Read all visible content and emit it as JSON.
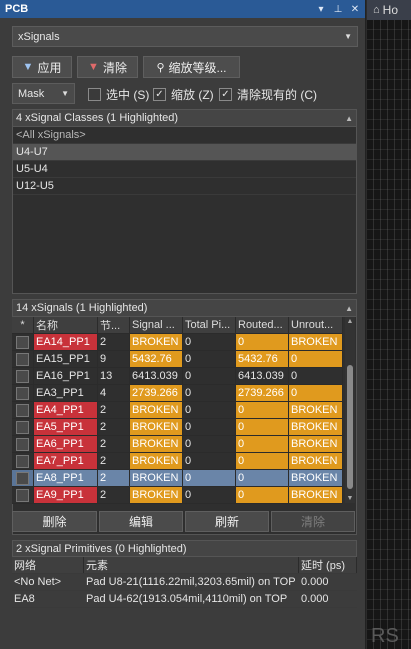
{
  "panel": {
    "title": "PCB",
    "controls": [
      "▾",
      "📌",
      "✕"
    ]
  },
  "type_select": {
    "value": "xSignals"
  },
  "toolbar": {
    "apply_label": "应用",
    "clear_label": "清除",
    "zoom_level_label": "缩放等级..."
  },
  "mask_select": {
    "value": "Mask"
  },
  "options": {
    "select_label": "选中 (S)",
    "select_checked": false,
    "zoom_label": "缩放 (Z)",
    "zoom_checked": true,
    "clear_existing_label": "清除现有的 (C)",
    "clear_existing_checked": true
  },
  "classes": {
    "header": "4 xSignal Classes (1 Highlighted)",
    "items": [
      {
        "label": "<All xSignals>",
        "state": "all"
      },
      {
        "label": "U4-U7",
        "state": "selected"
      },
      {
        "label": "U5-U4",
        "state": "normal"
      },
      {
        "label": "U12-U5",
        "state": "normal"
      }
    ]
  },
  "signals": {
    "header": "14 xSignals (1 Highlighted)",
    "columns": [
      "*",
      "名称",
      "节...",
      "Signal ...",
      "Total Pi...",
      "Routed...",
      "Unrout..."
    ],
    "rows": [
      {
        "name": "EA14_PP1",
        "nodes": "2",
        "signal": "BROKEN",
        "total": "0",
        "routed": "0",
        "unrouted": "BROKEN",
        "name_color": "red",
        "signal_color": "orange",
        "routed_color": "orange",
        "unrouted_color": "orange"
      },
      {
        "name": "EA15_PP1",
        "nodes": "9",
        "signal": "5432.76",
        "total": "0",
        "routed": "5432.76",
        "unrouted": "0",
        "name_color": "none",
        "signal_color": "orange",
        "routed_color": "orange",
        "unrouted_color": "orange"
      },
      {
        "name": "EA16_PP1",
        "nodes": "13",
        "signal": "6413.039",
        "total": "0",
        "routed": "6413.039",
        "unrouted": "0",
        "name_color": "none",
        "signal_color": "none",
        "routed_color": "none",
        "unrouted_color": "none"
      },
      {
        "name": "EA3_PP1",
        "nodes": "4",
        "signal": "2739.266",
        "total": "0",
        "routed": "2739.266",
        "unrouted": "0",
        "name_color": "none",
        "signal_color": "orange",
        "routed_color": "orange",
        "unrouted_color": "orange"
      },
      {
        "name": "EA4_PP1",
        "nodes": "2",
        "signal": "BROKEN",
        "total": "0",
        "routed": "0",
        "unrouted": "BROKEN",
        "name_color": "red",
        "signal_color": "orange",
        "routed_color": "orange",
        "unrouted_color": "orange"
      },
      {
        "name": "EA5_PP1",
        "nodes": "2",
        "signal": "BROKEN",
        "total": "0",
        "routed": "0",
        "unrouted": "BROKEN",
        "name_color": "red",
        "signal_color": "orange",
        "routed_color": "orange",
        "unrouted_color": "orange"
      },
      {
        "name": "EA6_PP1",
        "nodes": "2",
        "signal": "BROKEN",
        "total": "0",
        "routed": "0",
        "unrouted": "BROKEN",
        "name_color": "red",
        "signal_color": "orange",
        "routed_color": "orange",
        "unrouted_color": "orange"
      },
      {
        "name": "EA7_PP1",
        "nodes": "2",
        "signal": "BROKEN",
        "total": "0",
        "routed": "0",
        "unrouted": "BROKEN",
        "name_color": "red",
        "signal_color": "orange",
        "routed_color": "orange",
        "unrouted_color": "orange"
      },
      {
        "name": "EA8_PP1",
        "nodes": "2",
        "signal": "BROKEN",
        "total": "0",
        "routed": "0",
        "unrouted": "BROKEN",
        "name_color": "selected",
        "signal_color": "selected",
        "routed_color": "selected",
        "unrouted_color": "selected"
      },
      {
        "name": "EA9_PP1",
        "nodes": "2",
        "signal": "BROKEN",
        "total": "0",
        "routed": "0",
        "unrouted": "BROKEN",
        "name_color": "red",
        "signal_color": "orange",
        "routed_color": "orange",
        "unrouted_color": "orange"
      }
    ]
  },
  "actions": {
    "delete_label": "删除",
    "edit_label": "编辑",
    "refresh_label": "刷新",
    "clear_label": "清除"
  },
  "primitives": {
    "header": "2 xSignal Primitives (0 Highlighted)",
    "columns": [
      "网络",
      "元素",
      "延时 (ps)"
    ],
    "rows": [
      {
        "net": "<No Net>",
        "element": "Pad U8-21(1116.22mil,3203.65mil) on TOP",
        "delay": "0.000"
      },
      {
        "net": "EA8",
        "element": "Pad U4-62(1913.054mil,4110mil) on TOP",
        "delay": "0.000"
      }
    ]
  },
  "right_tab": {
    "label": "Ho"
  },
  "right_label": "RS",
  "colors": {
    "red": "#c8323a",
    "orange": "#e09a1e",
    "selected": "#6a85a8",
    "titlebar": "#2a5a96"
  }
}
